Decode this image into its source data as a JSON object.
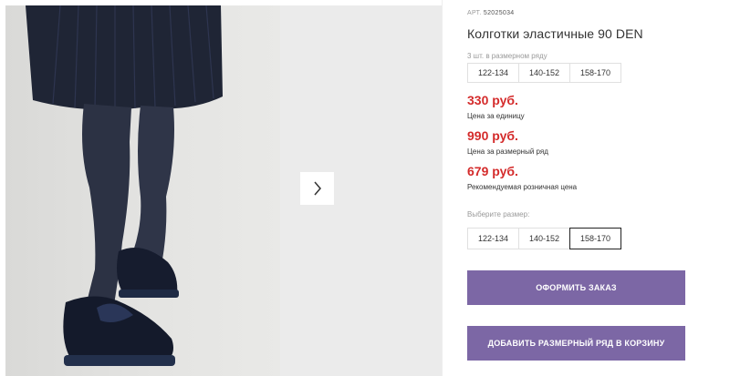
{
  "product": {
    "sku_label": "АРТ.",
    "sku": "52025034",
    "title": "Колготки эластичные 90 DEN",
    "size_row_label": "3 шт. в размерном ряду",
    "size_row": [
      "122-134",
      "140-152",
      "158-170"
    ],
    "prices": [
      {
        "value": "330 руб.",
        "label": "Цена за единицу"
      },
      {
        "value": "990 руб.",
        "label": "Цена за размерный ряд"
      },
      {
        "value": "679 руб.",
        "label": "Рекомендуемая розничная цена"
      }
    ],
    "choose_size_label": "Выберите размер:",
    "sizes": [
      "122-134",
      "140-152",
      "158-170"
    ],
    "selected_size": "158-170",
    "order_button": "ОФОРМИТЬ ЗАКАЗ",
    "add_to_cart_button": "ДОБАВИТЬ РАЗМЕРНЫЙ РЯД В КОРЗИНУ"
  },
  "gallery": {
    "next_icon": "chevron-right-icon"
  },
  "colors": {
    "price": "#d42b2b",
    "button": "#7c67a5",
    "tights": "#2c3244",
    "skirt": "#1f2535"
  }
}
